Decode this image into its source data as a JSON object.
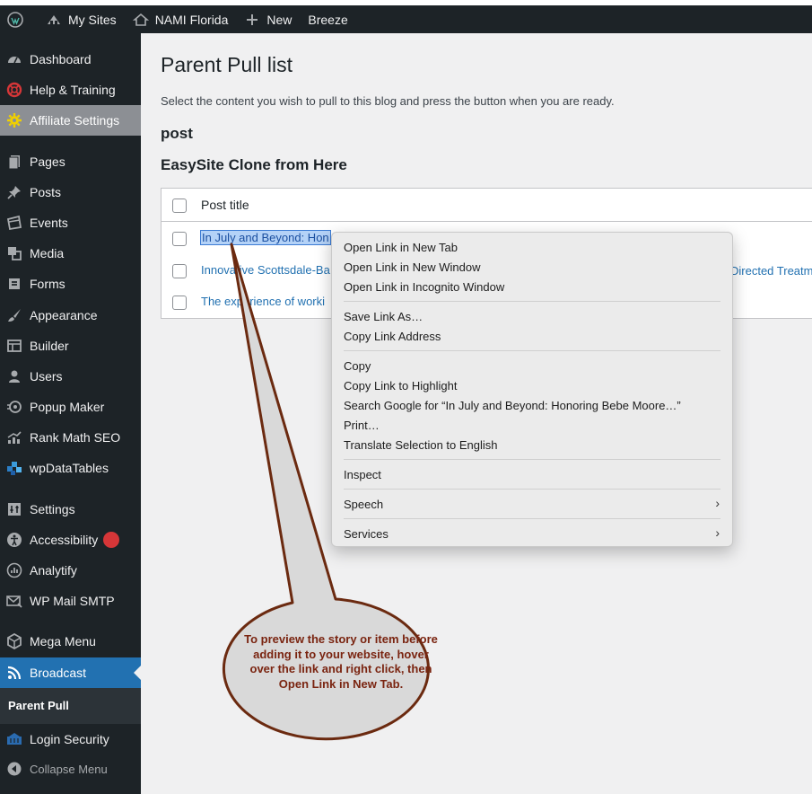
{
  "adminbar": {
    "my_sites": "My Sites",
    "site_name": "NAMI Florida",
    "new": "New",
    "breeze": "Breeze"
  },
  "sidebar": {
    "items": [
      {
        "label": "Dashboard",
        "icon": "dashboard-icon"
      },
      {
        "label": "Help & Training",
        "icon": "lifebuoy-icon"
      },
      {
        "label": "Affiliate Settings",
        "icon": "gear-icon"
      },
      {
        "label": "Pages",
        "icon": "pages-icon"
      },
      {
        "label": "Posts",
        "icon": "pin-icon"
      },
      {
        "label": "Events",
        "icon": "events-icon"
      },
      {
        "label": "Media",
        "icon": "media-icon"
      },
      {
        "label": "Forms",
        "icon": "forms-icon"
      },
      {
        "label": "Appearance",
        "icon": "brush-icon"
      },
      {
        "label": "Builder",
        "icon": "builder-icon"
      },
      {
        "label": "Users",
        "icon": "user-icon"
      },
      {
        "label": "Popup Maker",
        "icon": "popup-icon"
      },
      {
        "label": "Rank Math SEO",
        "icon": "chart-icon"
      },
      {
        "label": "wpDataTables",
        "icon": "table-icon"
      },
      {
        "label": "Settings",
        "icon": "settings-icon"
      },
      {
        "label": "Accessibility",
        "icon": "accessibility-icon"
      },
      {
        "label": "Analytify",
        "icon": "analytics-icon"
      },
      {
        "label": "WP Mail SMTP",
        "icon": "mail-icon"
      },
      {
        "label": "Mega Menu",
        "icon": "megamenu-icon"
      },
      {
        "label": "Broadcast",
        "icon": "rss-icon"
      }
    ],
    "submenu_current": "Parent Pull",
    "login_security": "Login Security",
    "collapse": "Collapse Menu"
  },
  "main": {
    "title": "Parent Pull list",
    "intro": "Select the content you wish to pull to this blog and press the button when you are ready.",
    "heading_post": "post",
    "heading_clone": "EasySite Clone from Here",
    "table": {
      "column": "Post title",
      "rows": [
        "In July and Beyond: Hon",
        "Innovative Scottsdale-Ba",
        "The experience of worki"
      ],
      "row2_right": "Directed Treatm"
    }
  },
  "context_menu": {
    "group1": [
      "Open Link in New Tab",
      "Open Link in New Window",
      "Open Link in Incognito Window"
    ],
    "group2": [
      "Save Link As…",
      "Copy Link Address"
    ],
    "group3": [
      "Copy",
      "Copy Link to Highlight",
      "Search Google for “In July and Beyond: Honoring Bebe Moore…”",
      "Print…",
      "Translate Selection to English"
    ],
    "inspect": "Inspect",
    "speech": "Speech",
    "services": "Services"
  },
  "callout": {
    "text": "To preview the story or item before adding it to your website, hover over the link and right click, then Open Link in New Tab."
  },
  "colors": {
    "sidebar_bg": "#1d2327",
    "active_blue": "#2271b1",
    "link": "#2271b1",
    "callout_fill": "#d9d9d9",
    "callout_stroke": "#6b2a10"
  }
}
